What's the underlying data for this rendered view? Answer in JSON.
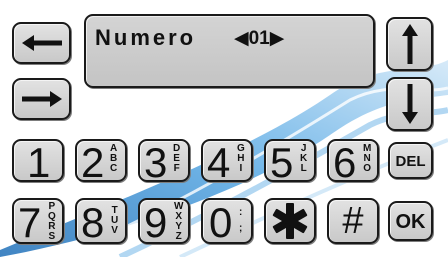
{
  "display": {
    "label": "Numero",
    "value": "◀01▶"
  },
  "nav": {
    "left_icon": "arrow-left-icon",
    "right_icon": "arrow-right-icon",
    "up_icon": "arrow-up-icon",
    "down_icon": "arrow-down-icon"
  },
  "keys": {
    "k1": {
      "digit": "1",
      "letters": []
    },
    "k2": {
      "digit": "2",
      "letters": [
        "A",
        "B",
        "C"
      ]
    },
    "k3": {
      "digit": "3",
      "letters": [
        "D",
        "E",
        "F"
      ]
    },
    "k4": {
      "digit": "4",
      "letters": [
        "G",
        "H",
        "I"
      ]
    },
    "k5": {
      "digit": "5",
      "letters": [
        "J",
        "K",
        "L"
      ]
    },
    "k6": {
      "digit": "6",
      "letters": [
        "M",
        "N",
        "O"
      ]
    },
    "k7": {
      "digit": "7",
      "letters": [
        "P",
        "Q",
        "R",
        "S"
      ]
    },
    "k8": {
      "digit": "8",
      "letters": [
        "T",
        "U",
        "V"
      ]
    },
    "k9": {
      "digit": "9",
      "letters": [
        "W",
        "X",
        "Y",
        "Z"
      ]
    },
    "k0": {
      "digit": "0",
      "letters": [
        ":",
        ";"
      ]
    },
    "star": {
      "symbol": "✱"
    },
    "hash": {
      "symbol": "#"
    },
    "del": {
      "label": "DEL"
    },
    "ok": {
      "label": "OK"
    }
  },
  "colors": {
    "key_fill": "#d6d6d6",
    "key_border": "#1a1a1a",
    "swoosh": "#4a9ad8"
  }
}
